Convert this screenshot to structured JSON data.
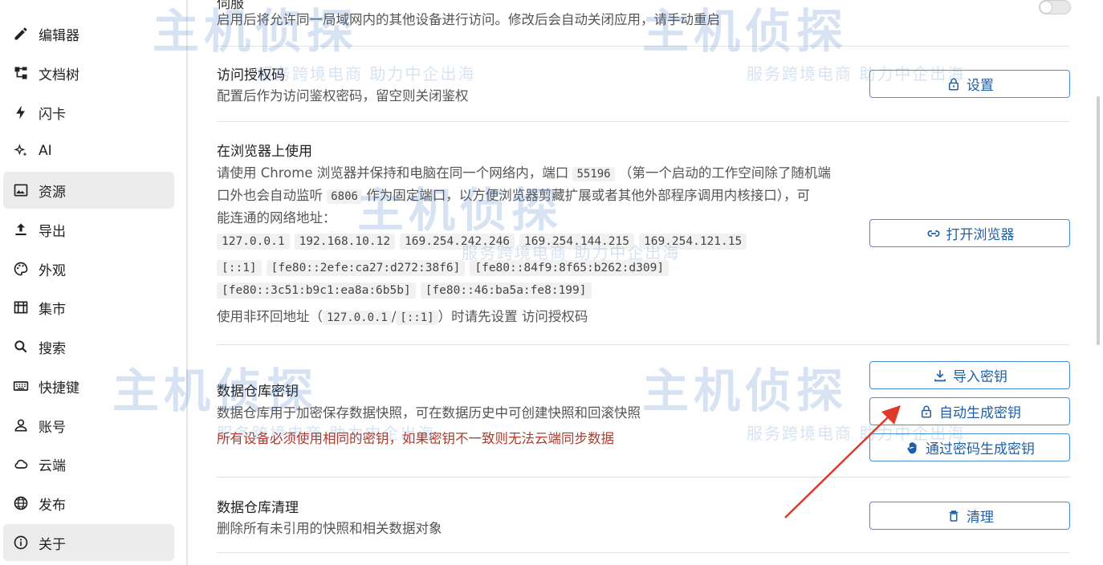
{
  "sidebar": {
    "items": [
      {
        "label": "编辑器",
        "icon": "pencil-icon",
        "active": false
      },
      {
        "label": "文档树",
        "icon": "tree-icon",
        "active": false
      },
      {
        "label": "闪卡",
        "icon": "bolt-icon",
        "active": false
      },
      {
        "label": "AI",
        "icon": "sparkle-icon",
        "active": false
      },
      {
        "label": "资源",
        "icon": "image-icon",
        "active": true
      },
      {
        "label": "导出",
        "icon": "upload-icon",
        "active": false
      },
      {
        "label": "外观",
        "icon": "palette-icon",
        "active": false
      },
      {
        "label": "集市",
        "icon": "store-icon",
        "active": false
      },
      {
        "label": "搜索",
        "icon": "search-icon",
        "active": false
      },
      {
        "label": "快捷键",
        "icon": "keyboard-icon",
        "active": false
      },
      {
        "label": "账号",
        "icon": "user-icon",
        "active": false
      },
      {
        "label": "云端",
        "icon": "cloud-icon",
        "active": false
      },
      {
        "label": "发布",
        "icon": "globe-icon",
        "active": false
      },
      {
        "label": "关于",
        "icon": "info-icon",
        "active": true
      }
    ]
  },
  "network_serve": {
    "title_partial": "伺服",
    "description": "启用后将允许同一局域网内的其他设备进行访问。修改后会自动关闭应用，请手动重启"
  },
  "access_code": {
    "title": "访问授权码",
    "description": "配置后作为访问鉴权密码，留空则关闭鉴权",
    "button_label": "设置",
    "button_icon": "lock-icon"
  },
  "browser_use": {
    "title": "在浏览器上使用",
    "desc_line1_a": "请使用 Chrome 浏览器并保持和电脑在同一个网络内，端口",
    "port": "55196",
    "desc_line1_b": "（第一个启动的工作空间除了随机端",
    "desc_line2_a": "口外也会自动监听",
    "fixed_port": "6806",
    "desc_line2_b": "作为固定端口，以方便浏览器剪藏扩展或者其他外部程序调用内核接口），可",
    "desc_line3": "能连通的网络地址：",
    "addresses_row1": [
      "127.0.0.1",
      "192.168.10.12",
      "169.254.242.246",
      "169.254.144.215",
      "169.254.121.15"
    ],
    "addresses_row2": [
      "[::1]",
      "[fe80::2efe:ca27:d272:38f6]",
      "[fe80::84f9:8f65:b262:d309]"
    ],
    "addresses_row3": [
      "[fe80::3c51:b9c1:ea8a:6b5b]",
      "[fe80::46:ba5a:fe8:199]"
    ],
    "note_a": "使用非环回地址（",
    "note_code1": "127.0.0.1",
    "note_sep": "/",
    "note_code2": "[::1]",
    "note_b": "）时请先设置 访问授权码",
    "button_label": "打开浏览器",
    "button_icon": "link-icon"
  },
  "repo_key": {
    "title": "数据仓库密钥",
    "description": "数据仓库用于加密保存数据快照，可在数据历史中可创建快照和回滚快照",
    "warning": "所有设备必须使用相同的密钥，如果密钥不一致则无法云端同步数据",
    "import_label": "导入密钥",
    "import_icon": "download-icon",
    "autogen_label": "自动生成密钥",
    "autogen_icon": "lock-icon",
    "passgen_label": "通过密码生成密钥",
    "passgen_icon": "hand-icon"
  },
  "repo_purge": {
    "title": "数据仓库清理",
    "description": "删除所有未引用的快照和相关数据对象",
    "button_label": "清理",
    "button_icon": "trash-icon"
  },
  "watermark": {
    "brand": "主机侦探",
    "slogan": "服务跨境电商 助力中企出海"
  },
  "colors": {
    "accent": "#4a90d9",
    "warning": "#b23a2b",
    "arrow": "#e0392b"
  }
}
